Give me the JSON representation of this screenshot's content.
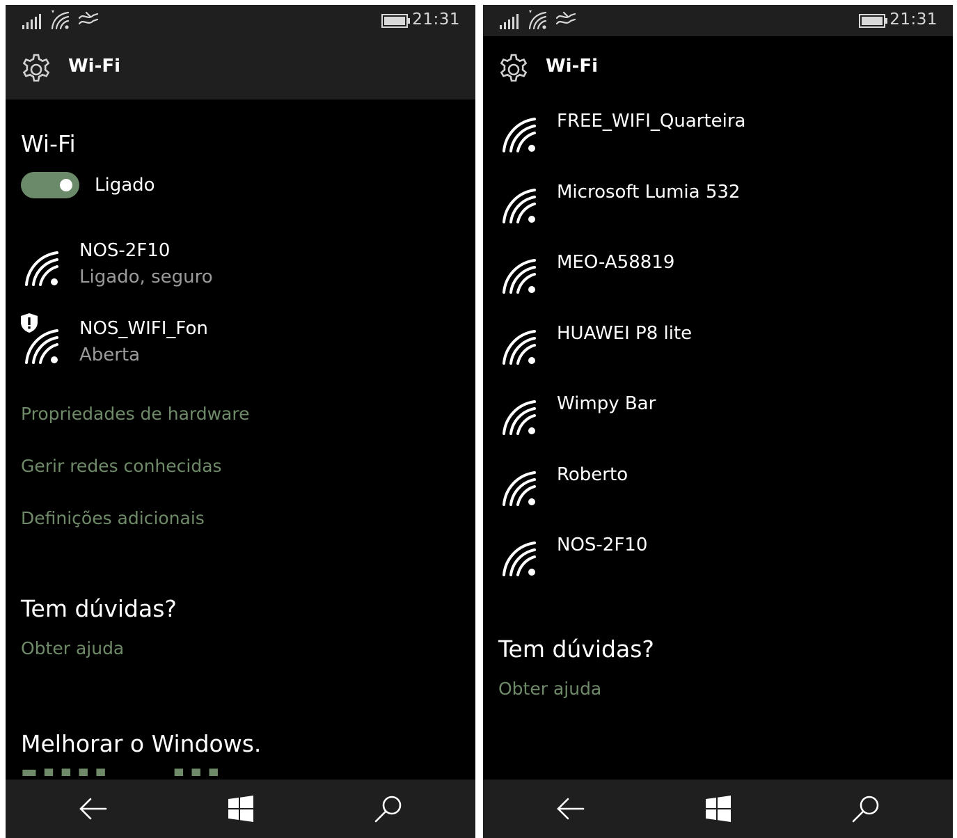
{
  "colors": {
    "background": "#000000",
    "chrome": "#1f1f1f",
    "accent_link": "#6f8a68",
    "toggle_on": "#6a8a6a",
    "secondary_text": "#9a9a9a"
  },
  "left": {
    "status_bar": {
      "time": "21:31",
      "icons": [
        "signal-bars-icon",
        "wifi-status-icon",
        "wireless-wave-icon",
        "battery-icon"
      ]
    },
    "header": {
      "icon": "gear-icon",
      "title": "Wi-Fi"
    },
    "wifi_section": {
      "title": "Wi-Fi",
      "toggle_label": "Ligado",
      "toggle_on": true
    },
    "networks": [
      {
        "name": "NOS-2F10",
        "status": "Ligado, seguro",
        "icon": "wifi-icon"
      },
      {
        "name": "NOS_WIFI_Fon",
        "status": "Aberta",
        "icon": "wifi-open-warning-icon"
      }
    ],
    "links": [
      "Propriedades de hardware",
      "Gerir redes conhecidas",
      "Definições adicionais"
    ],
    "help": {
      "title": "Tem dúvidas?",
      "link": "Obter ajuda"
    },
    "improve": {
      "title": "Melhorar o Windows."
    },
    "nav": {
      "icons": [
        "back-arrow-icon",
        "windows-start-icon",
        "search-icon"
      ]
    }
  },
  "right": {
    "status_bar": {
      "time": "21:31",
      "icons": [
        "signal-bars-icon",
        "wifi-status-icon",
        "wireless-wave-icon",
        "battery-icon"
      ]
    },
    "header": {
      "icon": "gear-icon",
      "title": "Wi-Fi"
    },
    "networks": [
      {
        "name": "FREE_WIFI_Quarteira",
        "icon": "wifi-icon"
      },
      {
        "name": "Microsoft Lumia 532",
        "icon": "wifi-icon"
      },
      {
        "name": "MEO-A58819",
        "icon": "wifi-icon"
      },
      {
        "name": "HUAWEI P8 lite",
        "icon": "wifi-icon"
      },
      {
        "name": "Wimpy Bar",
        "icon": "wifi-icon"
      },
      {
        "name": "Roberto",
        "icon": "wifi-icon"
      },
      {
        "name": "NOS-2F10",
        "icon": "wifi-icon"
      }
    ],
    "help": {
      "title": "Tem dúvidas?",
      "link": "Obter ajuda"
    },
    "nav": {
      "icons": [
        "back-arrow-icon",
        "windows-start-icon",
        "search-icon"
      ]
    }
  }
}
